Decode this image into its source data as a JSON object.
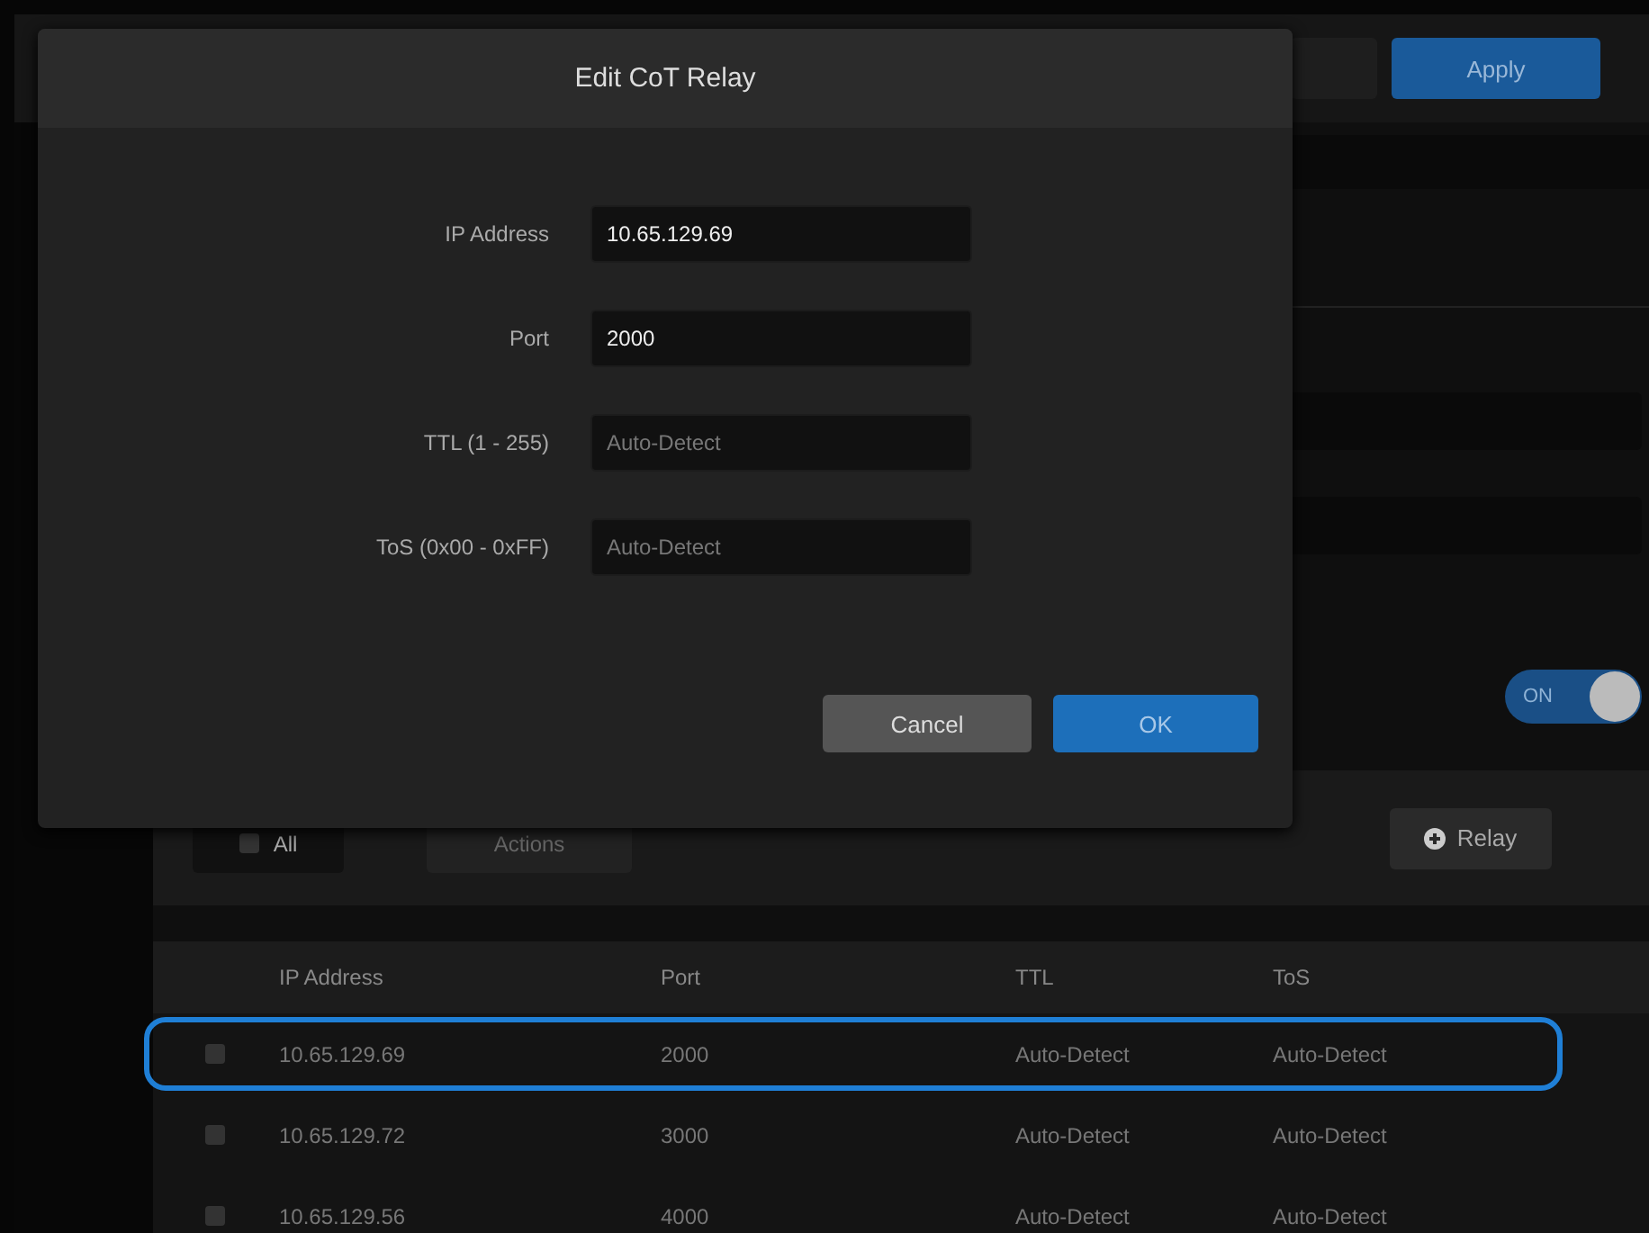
{
  "top_bar": {
    "apply_button": "Apply"
  },
  "toggle": {
    "on": true,
    "label": "ON"
  },
  "relay_toolbar": {
    "select_all": {
      "label": "All",
      "checked": false
    },
    "actions_dropdown": "Actions",
    "add_button": "Relay"
  },
  "table": {
    "columns": [
      "IP Address",
      "Port",
      "TTL",
      "ToS"
    ],
    "rows": [
      {
        "checked": false,
        "highlighted": true,
        "cells": [
          "10.65.129.69",
          "2000",
          "Auto-Detect",
          "Auto-Detect"
        ]
      },
      {
        "checked": false,
        "highlighted": false,
        "cells": [
          "10.65.129.72",
          "3000",
          "Auto-Detect",
          "Auto-Detect"
        ]
      },
      {
        "checked": false,
        "highlighted": false,
        "cells": [
          "10.65.129.56",
          "4000",
          "Auto-Detect",
          "Auto-Detect"
        ]
      }
    ]
  },
  "dialog": {
    "title": "Edit CoT Relay",
    "fields": [
      {
        "label": "IP Address",
        "value": "10.65.129.69"
      },
      {
        "label": "Port",
        "value": "2000"
      },
      {
        "label": "TTL (1 - 255)",
        "placeholder": "Auto-Detect"
      },
      {
        "label": "ToS (0x00 - 0xFF)",
        "placeholder": "Auto-Detect"
      }
    ],
    "buttons": [
      {
        "label": "Cancel",
        "kind": "secondary"
      },
      {
        "label": "OK",
        "kind": "primary"
      }
    ]
  }
}
